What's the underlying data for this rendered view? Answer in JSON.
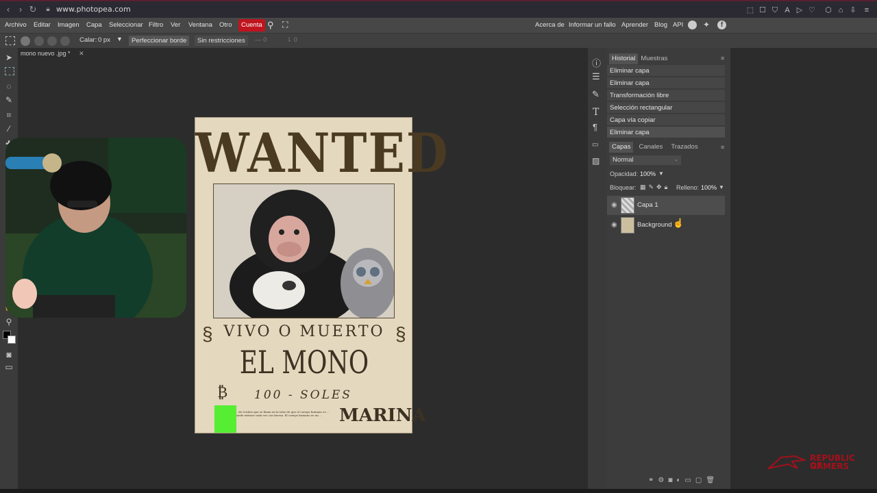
{
  "browser": {
    "url": "www.photopea.com"
  },
  "menu": {
    "items": [
      "Archivo",
      "Editar",
      "Imagen",
      "Capa",
      "Seleccionar",
      "Filtro",
      "Ver",
      "Ventana",
      "Otro"
    ],
    "cuenta": "Cuenta",
    "right_links": [
      "Acerca de",
      "Informar un fallo",
      "Aprender",
      "Blog",
      "API"
    ]
  },
  "tool_options": {
    "calar_label": "Calar:",
    "calar_value": "0 px",
    "perfeccionar": "Perfeccionar borde",
    "restriction": "Sin restricciones",
    "w_value": "0",
    "h_value": "0"
  },
  "document": {
    "tab_title": "mono nuevo .jpg *"
  },
  "poster": {
    "wanted": "WANTED",
    "vivo_o_muerto": "VIVO O MUERTO",
    "name": "EL MONO",
    "bounty": "100 - SOLES",
    "marina": "MARINA",
    "fine_print": "... de Gorilas que se llama en la islas de que el cuerpo humano es ... puede extraer cada vez con fuerza. El cuerpo humano es un ..."
  },
  "history": {
    "tabs": [
      "Historial",
      "Muestras"
    ],
    "items": [
      "Eliminar capa",
      "Eliminar capa",
      "Transformación libre",
      "Selección rectangular",
      "Capa vía copiar",
      "Eliminar capa"
    ]
  },
  "layers": {
    "tabs": [
      "Capas",
      "Canales",
      "Trazados"
    ],
    "blend_mode": "Normal",
    "opacity_label": "Opacidad:",
    "opacity_value": "100%",
    "lock_label": "Bloquear:",
    "fill_label": "Relleno:",
    "fill_value": "100%",
    "items": [
      {
        "name": "Capa 1"
      },
      {
        "name": "Background"
      }
    ]
  },
  "watermark": {
    "line1": "REPUBLIC OF",
    "line2": "GAMERS"
  },
  "colors": {
    "accent": "#c0141e",
    "panel": "#3c3c3c",
    "workspace": "#2c2c2c"
  }
}
